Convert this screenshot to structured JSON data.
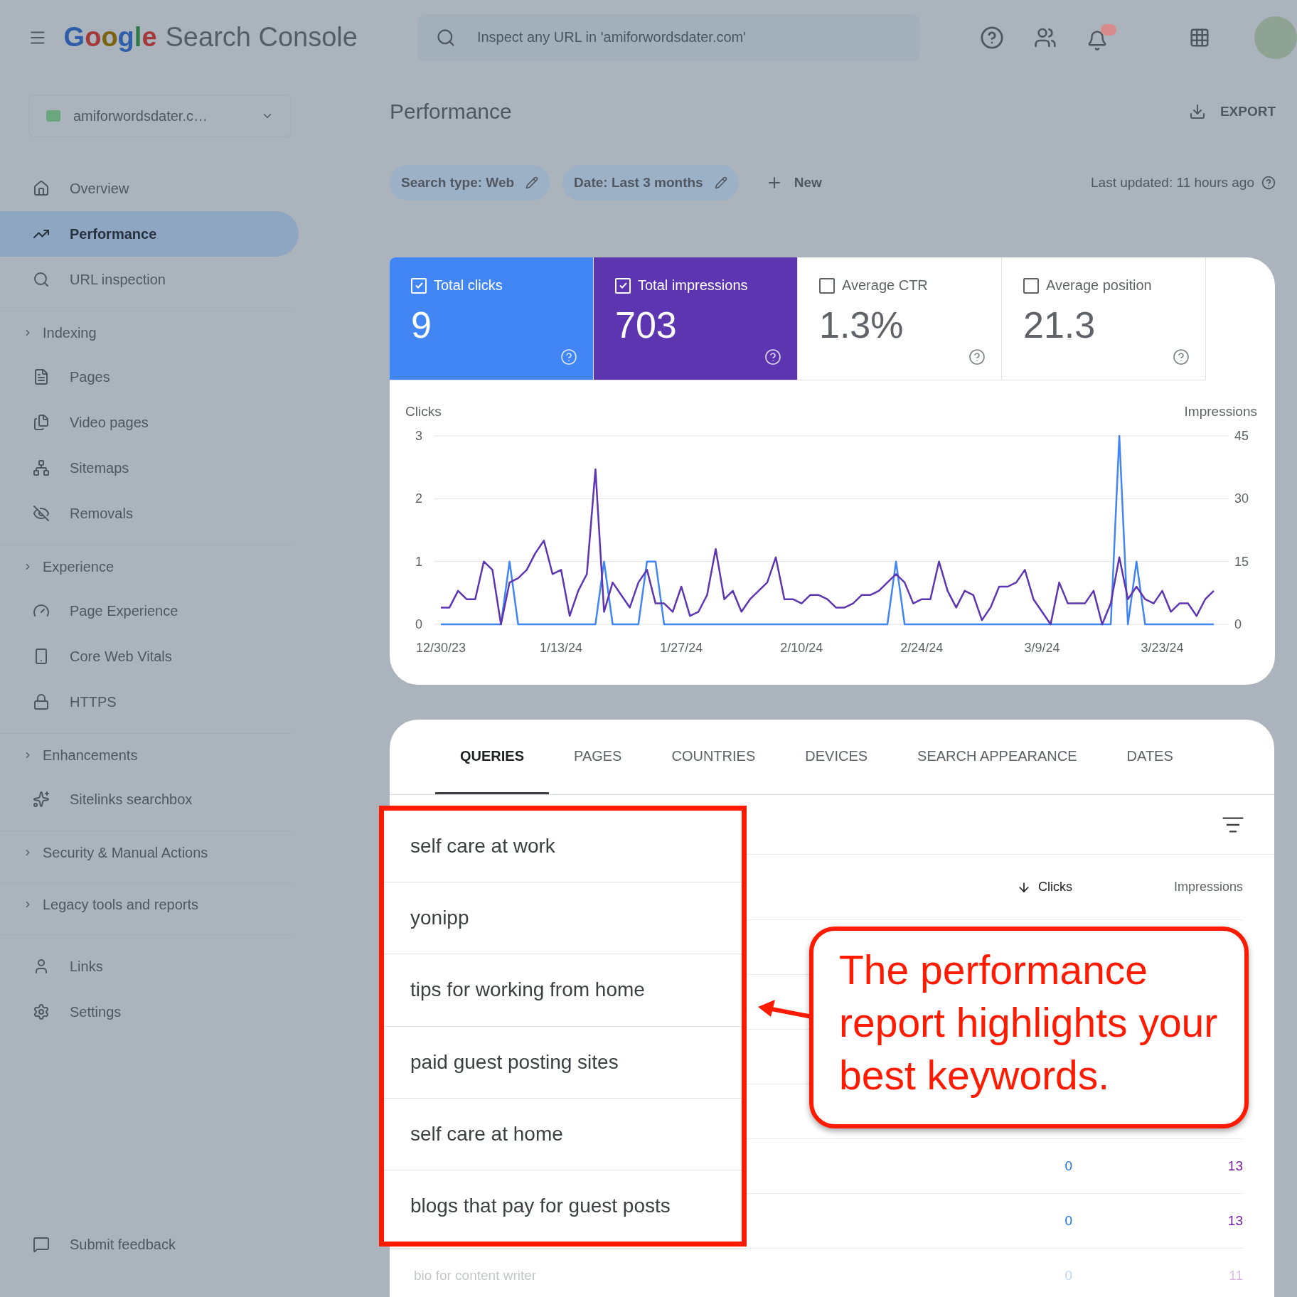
{
  "header": {
    "logo": "Google",
    "product": "Search Console",
    "search": {
      "placeholder": "Inspect any URL in 'amiforwordsdater.com'"
    }
  },
  "sidebar": {
    "property": "amiforwordsdater.c…",
    "groups": [
      {
        "items": [
          {
            "label": "Overview",
            "selected": false
          },
          {
            "label": "Performance",
            "selected": true
          },
          {
            "label": "URL inspection",
            "selected": false
          }
        ]
      },
      {
        "title": "Indexing",
        "items": [
          {
            "label": "Pages",
            "selected": false
          },
          {
            "label": "Video pages",
            "selected": false
          },
          {
            "label": "Sitemaps",
            "selected": false
          },
          {
            "label": "Removals",
            "selected": false
          }
        ]
      },
      {
        "title": "Experience",
        "items": [
          {
            "label": "Page Experience",
            "selected": false
          },
          {
            "label": "Core Web Vitals",
            "selected": false
          },
          {
            "label": "HTTPS",
            "selected": false
          }
        ]
      },
      {
        "title": "Enhancements",
        "items": [
          {
            "label": "Sitelinks searchbox",
            "selected": false
          }
        ]
      },
      {
        "title": "Security & Manual Actions"
      },
      {
        "title": "Legacy tools and reports"
      },
      {
        "items": [
          {
            "label": "Links",
            "selected": false
          },
          {
            "label": "Settings",
            "selected": false
          }
        ]
      }
    ],
    "feedback": "Submit feedback"
  },
  "page": {
    "title": "Performance",
    "export": "EXPORT",
    "filters": [
      {
        "label": "Search type: Web"
      },
      {
        "label": "Date: Last 3 months"
      }
    ],
    "new_button": "New",
    "last_updated": "Last updated: 11 hours ago"
  },
  "metrics": [
    {
      "label": "Total clicks",
      "value": "9",
      "checked": true,
      "color": "#4285f4"
    },
    {
      "label": "Total impressions",
      "value": "703",
      "checked": true,
      "color": "#5e35b1"
    },
    {
      "label": "Average CTR",
      "value": "1.3%",
      "checked": false
    },
    {
      "label": "Average position",
      "value": "21.3",
      "checked": false
    }
  ],
  "chart": {
    "chart_data": {
      "type": "line",
      "ylabel": "Clicks",
      "y2label": "Impressions",
      "ylim": [
        0,
        3
      ],
      "yticks": [
        0,
        1,
        2,
        3
      ],
      "y2lim": [
        0,
        45
      ],
      "y2ticks": [
        0,
        15,
        30,
        45
      ],
      "categories": [
        "12/30/23",
        null,
        null,
        null,
        null,
        null,
        null,
        null,
        null,
        null,
        null,
        null,
        null,
        null,
        "1/13/24",
        null,
        null,
        null,
        null,
        null,
        null,
        null,
        null,
        null,
        null,
        null,
        null,
        null,
        "1/27/24",
        null,
        null,
        null,
        null,
        null,
        null,
        null,
        null,
        null,
        null,
        null,
        null,
        null,
        "2/10/24",
        null,
        null,
        null,
        null,
        null,
        null,
        null,
        null,
        null,
        null,
        null,
        null,
        null,
        "2/24/24",
        null,
        null,
        null,
        null,
        null,
        null,
        null,
        null,
        null,
        null,
        null,
        null,
        null,
        "3/9/24",
        null,
        null,
        null,
        null,
        null,
        null,
        null,
        null,
        null,
        null,
        null,
        null,
        null,
        "3/23/24",
        null,
        null,
        null,
        null,
        null,
        null
      ],
      "series": [
        {
          "color": "#4285f4",
          "values": [
            0,
            0,
            0,
            0,
            0,
            0,
            0,
            0,
            1,
            0,
            0,
            0,
            0,
            0,
            0,
            0,
            0,
            0,
            0,
            1,
            0,
            0,
            0,
            0,
            1,
            1,
            0,
            0,
            0,
            0,
            0,
            0,
            0,
            0,
            0,
            0,
            0,
            0,
            0,
            0,
            0,
            0,
            0,
            0,
            0,
            0,
            0,
            0,
            0,
            0,
            0,
            0,
            0,
            1,
            0,
            0,
            0,
            0,
            0,
            0,
            0,
            0,
            0,
            0,
            0,
            0,
            0,
            0,
            0,
            0,
            0,
            0,
            0,
            0,
            0,
            0,
            0,
            0,
            0,
            3,
            0,
            1,
            0,
            0,
            0,
            0,
            0,
            0,
            0,
            0,
            0
          ]
        },
        {
          "color": "#5e35b1",
          "axis": "y2",
          "values": [
            4,
            4,
            8,
            6,
            6,
            15,
            13,
            0,
            10,
            11,
            13,
            17,
            20,
            12,
            13,
            2,
            8,
            12,
            37,
            3,
            10,
            7,
            4,
            10,
            13,
            5,
            5,
            3,
            9,
            2,
            3,
            7,
            18,
            6,
            8,
            3,
            6,
            8,
            10,
            16,
            6,
            6,
            5,
            7,
            7,
            6,
            4,
            4,
            5,
            7,
            7,
            8,
            10,
            12,
            10,
            5,
            6,
            6,
            15,
            8,
            4,
            8,
            7,
            1,
            4,
            9,
            9,
            10,
            13,
            6,
            3,
            0,
            10,
            5,
            5,
            5,
            8,
            0,
            5,
            16,
            6,
            9,
            6,
            5,
            8,
            3,
            5,
            5,
            2,
            6,
            8
          ]
        }
      ]
    }
  },
  "table": {
    "tabs": [
      {
        "label": "QUERIES",
        "selected": true
      },
      {
        "label": "PAGES",
        "selected": false
      },
      {
        "label": "COUNTRIES",
        "selected": false
      },
      {
        "label": "DEVICES",
        "selected": false
      },
      {
        "label": "SEARCH APPEARANCE",
        "selected": false
      },
      {
        "label": "DATES",
        "selected": false
      }
    ],
    "columns": [
      {
        "label": "Clicks",
        "sorted": true
      },
      {
        "label": "Impressions",
        "sorted": false
      }
    ],
    "rows": [
      {
        "clicks": "0",
        "impressions": "13",
        "faded": false
      },
      {
        "clicks": "0",
        "impressions": "13",
        "faded": false
      },
      {
        "query": "bio for content writer",
        "clicks": "0",
        "impressions": "11",
        "faded": true
      }
    ]
  },
  "highlight": {
    "queries": [
      "self care at work",
      "yonipp",
      "tips for working from home",
      "paid guest posting sites",
      "self care at home",
      "blogs that pay for guest posts"
    ],
    "callout": "The performance report highlights your best keywords."
  }
}
